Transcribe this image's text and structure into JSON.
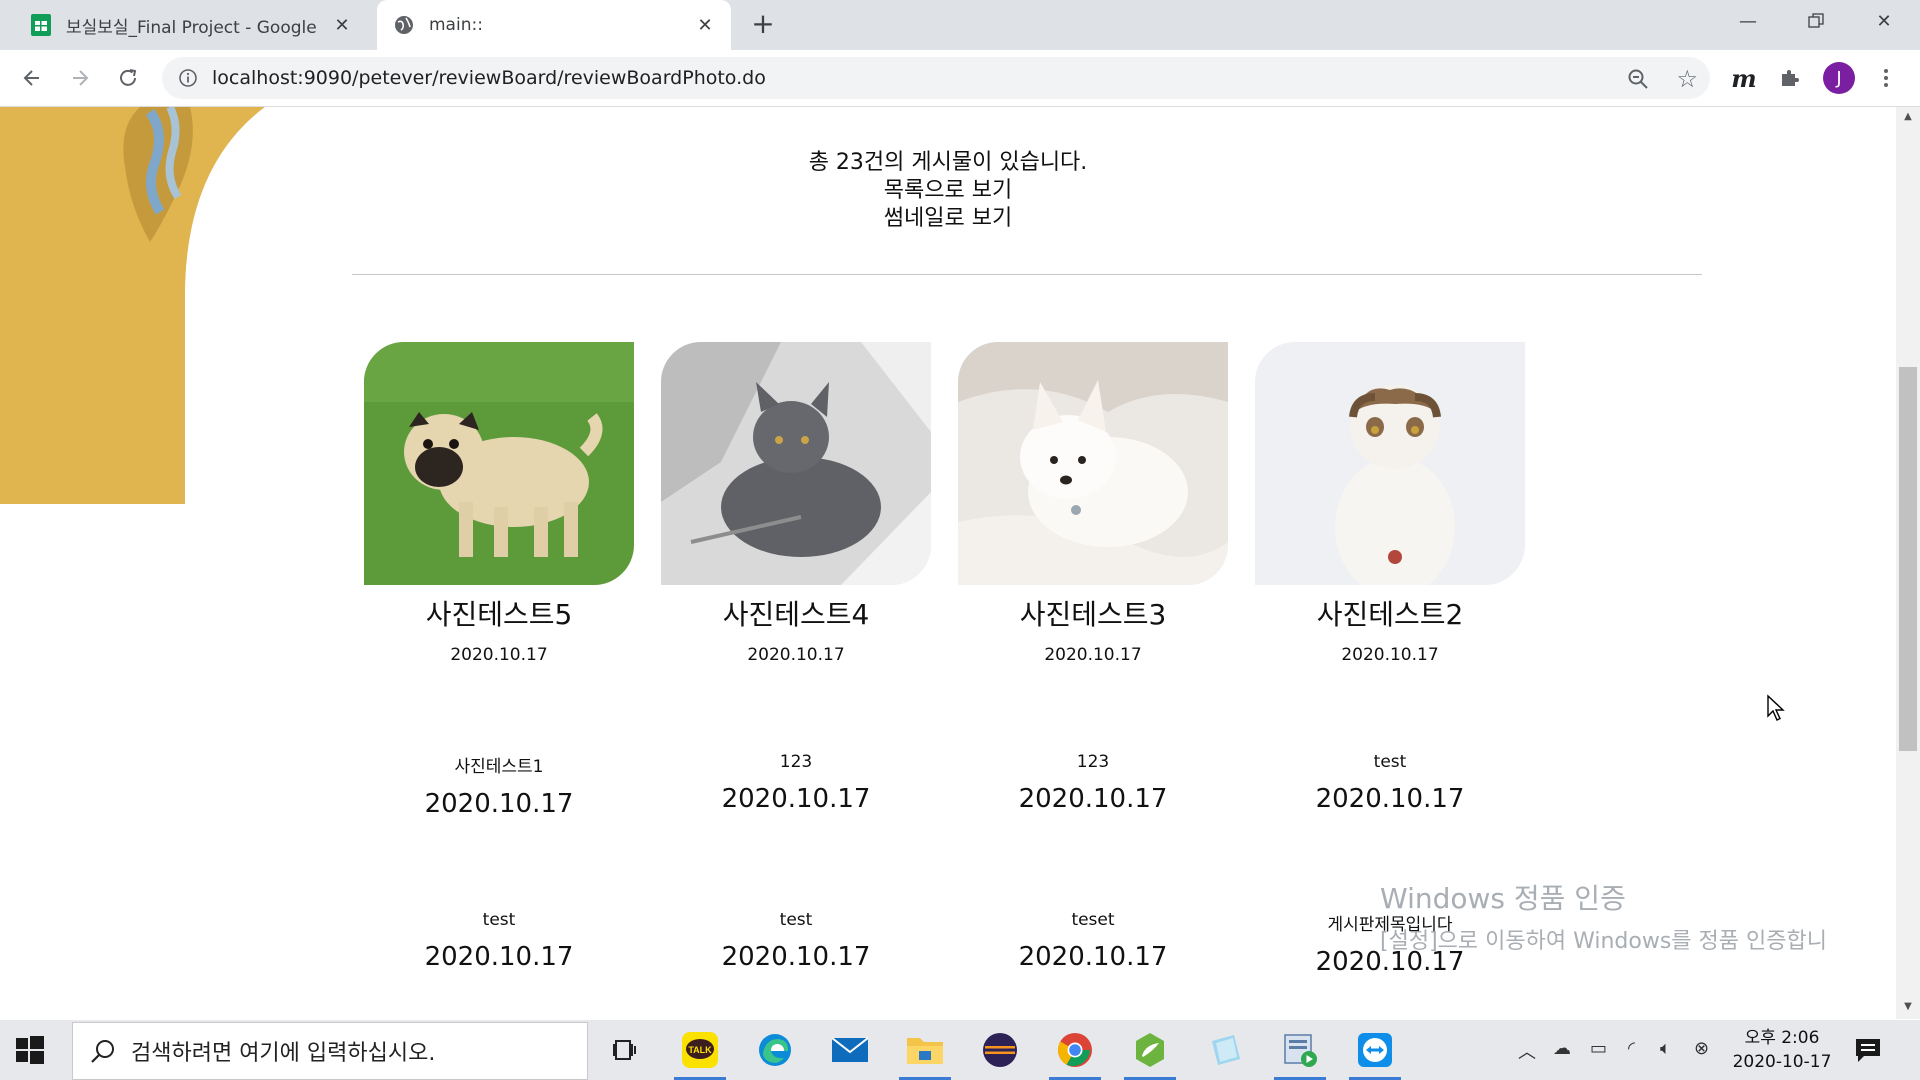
{
  "browser": {
    "tabs": [
      {
        "title": "보실보실_Final Project - Google"
      },
      {
        "title": "main::"
      }
    ],
    "url": "localhost:9090/petever/reviewBoard/reviewBoardPhoto.do",
    "avatar_letter": "J",
    "extension_m": "m"
  },
  "page": {
    "summary": {
      "count_text": "총 23건의 게시물이 있습니다.",
      "list_view": "목록으로 보기",
      "thumb_view": "썸네일로 보기"
    },
    "photo_cards": [
      {
        "title": "사진테스트5",
        "date": "2020.10.17",
        "image": "pug-on-grass"
      },
      {
        "title": "사진테스트4",
        "date": "2020.10.17",
        "image": "gray-cat-on-blanket"
      },
      {
        "title": "사진테스트3",
        "date": "2020.10.17",
        "image": "white-puppy-on-bed"
      },
      {
        "title": "사진테스트2",
        "date": "2020.10.17",
        "image": "scottish-fold-cat"
      }
    ],
    "text_items_row1": [
      {
        "title": "사진테스트1",
        "date": "2020.10.17"
      },
      {
        "title": "123",
        "date": "2020.10.17"
      },
      {
        "title": "123",
        "date": "2020.10.17"
      },
      {
        "title": "test",
        "date": "2020.10.17"
      }
    ],
    "text_items_row2": [
      {
        "title": "test",
        "date": "2020.10.17"
      },
      {
        "title": "test",
        "date": "2020.10.17"
      },
      {
        "title": "teset",
        "date": "2020.10.17"
      },
      {
        "title": "게시판제목입니다",
        "date": "2020.10.17"
      }
    ]
  },
  "watermark": {
    "line1": "Windows 정품 인증",
    "line2": "[설정]으로 이동하여 Windows를 정품 인증합니",
    "color": "#9aa0a6"
  },
  "taskbar": {
    "search_placeholder": "검색하려면 여기에 입력하십시오.",
    "clock_time": "오후 2:06",
    "clock_date": "2020-10-17",
    "kakao_label": "TALK"
  },
  "colors": {
    "deco_yellow": "#e0b44e",
    "tab_bg": "#dee1e6",
    "accent_blue": "#3a7bd5"
  }
}
